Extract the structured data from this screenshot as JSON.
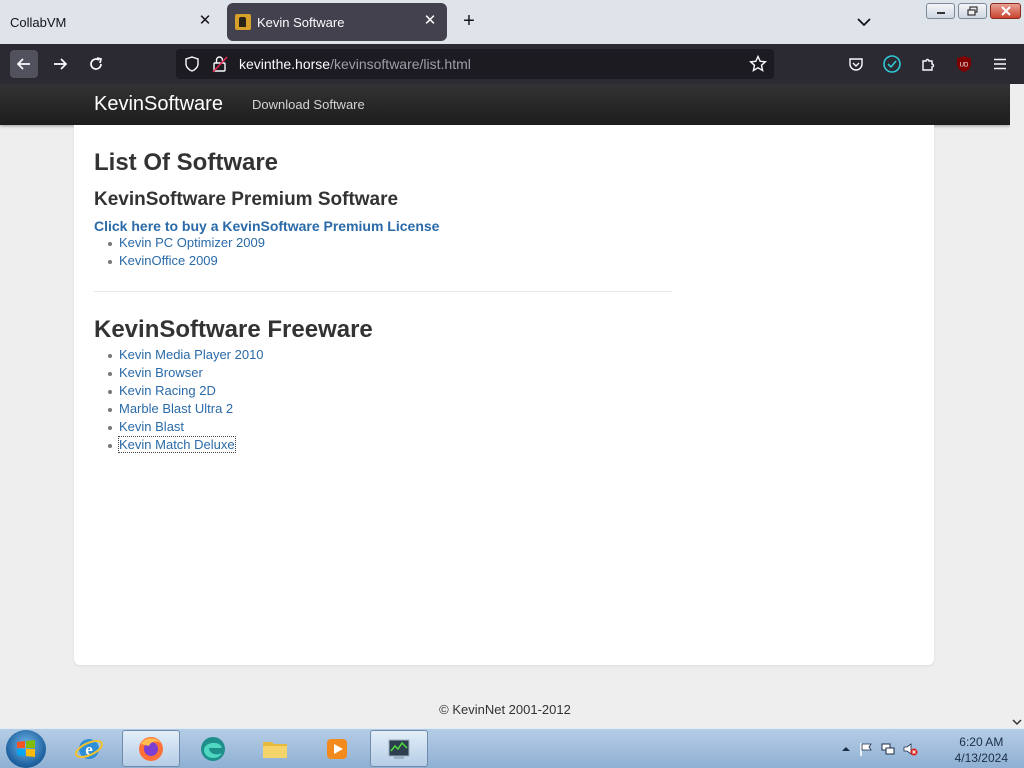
{
  "browser": {
    "tabs": [
      {
        "title": "CollabVM"
      },
      {
        "title": "Kevin Software"
      }
    ],
    "url": {
      "host": "kevinthe.horse",
      "path": "/kevinsoftware/list.html"
    }
  },
  "site": {
    "brand": "KevinSoftware",
    "nav_link": "Download Software",
    "page_title": "List Of Software",
    "premium": {
      "heading": "KevinSoftware Premium Software",
      "license_link": "Click here to buy a KevinSoftware Premium License",
      "items": [
        "Kevin PC Optimizer 2009",
        "KevinOffice 2009"
      ]
    },
    "freeware": {
      "heading": "KevinSoftware Freeware",
      "items": [
        "Kevin Media Player 2010",
        "Kevin Browser",
        "Kevin Racing 2D",
        "Marble Blast Ultra 2",
        "Kevin Blast",
        "Kevin Match Deluxe"
      ]
    },
    "footer": "© KevinNet 2001-2012"
  },
  "taskbar": {
    "apps": [
      "internet-explorer",
      "firefox",
      "edge",
      "file-explorer",
      "media-player",
      "task-manager"
    ],
    "clock": {
      "time": "6:20 AM",
      "date": "4/13/2024"
    }
  },
  "colors": {
    "link": "#2a6aa8",
    "navbar": "#222222",
    "browser_chrome": "#2b2a33"
  }
}
